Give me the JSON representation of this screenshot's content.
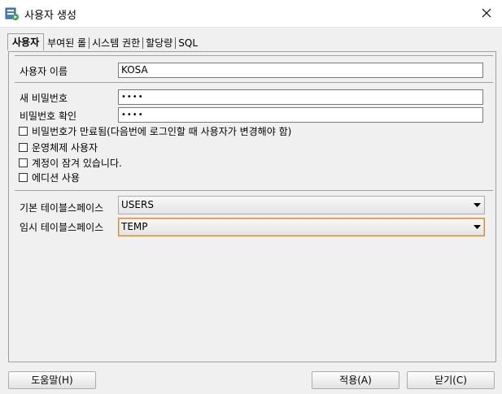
{
  "window": {
    "title": "사용자 생성"
  },
  "tabs": [
    {
      "label": "사용자",
      "active": true
    },
    {
      "label": "부여된 롤"
    },
    {
      "label": "시스템 권한"
    },
    {
      "label": "할당량"
    },
    {
      "label": "SQL"
    }
  ],
  "user": {
    "name_label": "사용자 이름",
    "name_value": "KOSA",
    "new_password_label": "새 비밀번호",
    "new_password_value": "••••",
    "confirm_password_label": "비밀번호 확인",
    "confirm_password_value": "••••",
    "checkboxes": [
      {
        "label": "비밀번호가 만료됨(다음번에 로그인할 때 사용자가 변경해야 함)",
        "checked": false
      },
      {
        "label": "운영체제 사용자",
        "checked": false
      },
      {
        "label": "계정이 잠겨 있습니다.",
        "checked": false
      },
      {
        "label": "에디션 사용",
        "checked": false
      }
    ],
    "default_tablespace_label": "기본 테이블스페이스",
    "default_tablespace_value": "USERS",
    "temp_tablespace_label": "임시 테이블스페이스",
    "temp_tablespace_value": "TEMP"
  },
  "buttons": {
    "help": "도움말(H)",
    "apply": "적용(A)",
    "close": "닫기(C)"
  },
  "colors": {
    "focus_border": "#c88d3c",
    "window_bg": "#f0f0f0"
  }
}
